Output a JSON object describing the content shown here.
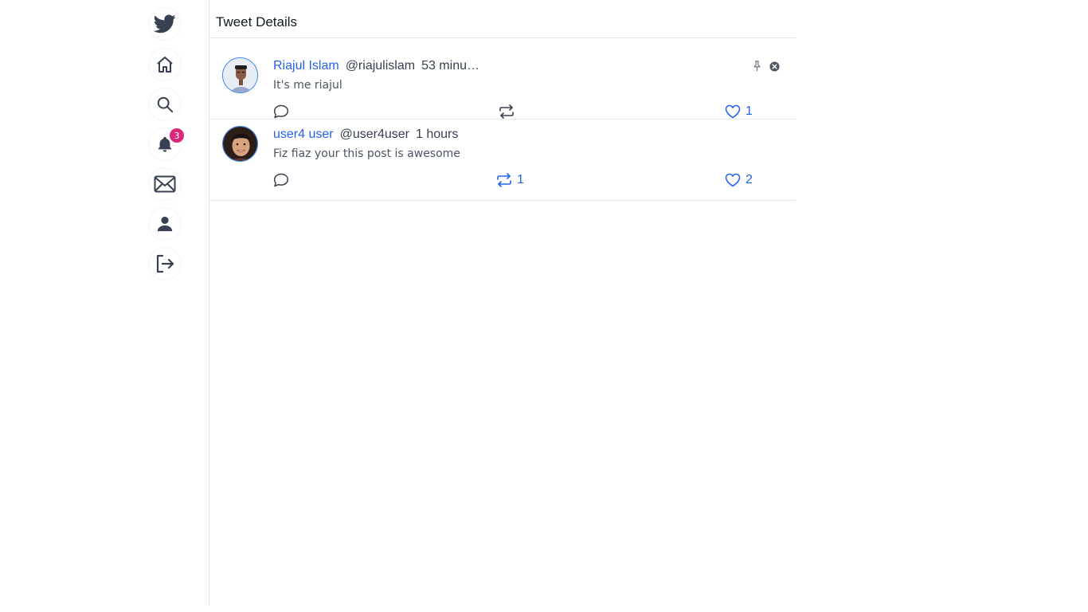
{
  "header": {
    "title": "Tweet Details"
  },
  "sidebar": {
    "notifications_badge": "3"
  },
  "tweets": [
    {
      "name": "Riajul Islam",
      "handle": "@riajulislam",
      "time": "53 minu…",
      "text": "It's me riajul",
      "retweets": "",
      "likes": "1"
    },
    {
      "name": "user4 user",
      "handle": "@user4user",
      "time": "1 hours",
      "text": "Fiz fiaz your this post is awesome",
      "retweets": "1",
      "likes": "2"
    }
  ],
  "colors": {
    "accent": "#2563eb",
    "badge": "#db2777",
    "text": "#374151"
  }
}
